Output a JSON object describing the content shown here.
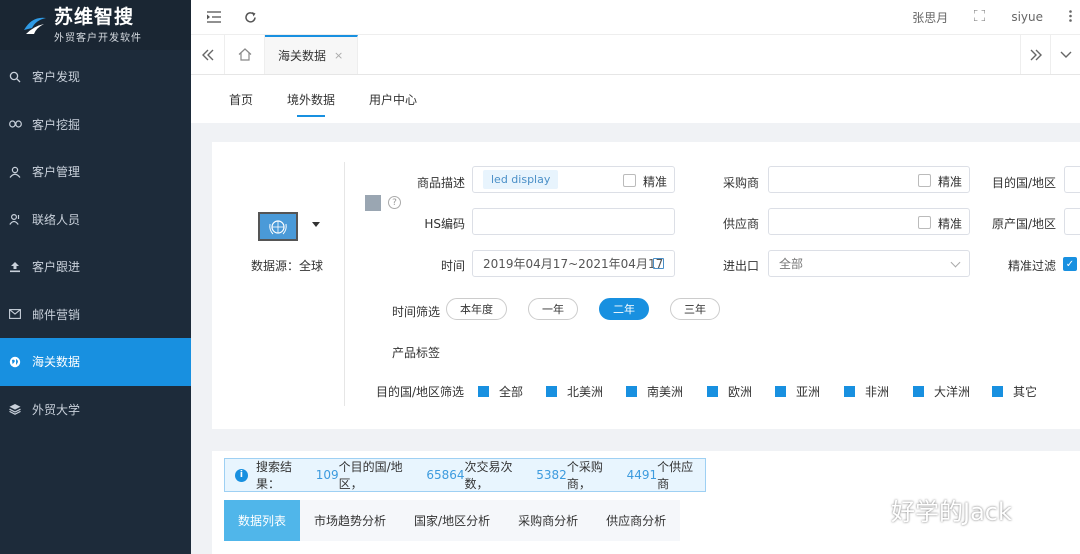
{
  "brand": {
    "title": "苏维智搜",
    "subtitle": "外贸客户开发软件"
  },
  "sidebar": {
    "items": [
      {
        "label": "客户发现",
        "icon": "search-icon"
      },
      {
        "label": "客户挖掘",
        "icon": "link-icon"
      },
      {
        "label": "客户管理",
        "icon": "user-icon"
      },
      {
        "label": "联络人员",
        "icon": "contact-icon"
      },
      {
        "label": "客户跟进",
        "icon": "upload-icon"
      },
      {
        "label": "邮件营销",
        "icon": "mail-icon"
      },
      {
        "label": "海关数据",
        "icon": "globe-icon",
        "active": true
      },
      {
        "label": "外贸大学",
        "icon": "layers-icon"
      }
    ]
  },
  "topbar": {
    "user_name": "张思月",
    "account": "siyue"
  },
  "tabstrip": {
    "open_tab": "海关数据"
  },
  "subnav": {
    "items": [
      "首页",
      "境外数据",
      "用户中心"
    ],
    "active": "境外数据"
  },
  "search": {
    "datasource_label": "数据源：全球",
    "product_desc_label": "商品描述",
    "product_desc_tag": "led display",
    "exact_label": "精准",
    "buyer_label": "采购商",
    "dest_country_label": "目的国/地区",
    "hs_label": "HS编码",
    "supplier_label": "供应商",
    "origin_country_label": "原产国/地区",
    "time_label": "时间",
    "time_value": "2019年04月17~2021年04月17",
    "io_label": "进出口",
    "io_value": "全部",
    "exact_filter_label": "精准过滤",
    "time_filter_label": "时间筛选",
    "time_filters": [
      "本年度",
      "一年",
      "二年",
      "三年"
    ],
    "time_filter_active": "二年",
    "product_tags_label": "产品标签",
    "region_filter_label": "目的国/地区筛选",
    "regions": [
      "全部",
      "北美洲",
      "南美洲",
      "欧洲",
      "亚洲",
      "非洲",
      "大洋洲",
      "其它"
    ]
  },
  "result": {
    "prefix": "搜索结果：",
    "dest_count": "109",
    "dest_suffix": "个目的国/地区，",
    "trade_count": "65864",
    "trade_suffix": "次交易次数，",
    "buyer_count": "5382",
    "buyer_suffix": "个采购商，",
    "supplier_count": "4491",
    "supplier_suffix": "个供应商"
  },
  "result_tabs": [
    "数据列表",
    "市场趋势分析",
    "国家/地区分析",
    "采购商分析",
    "供应商分析"
  ],
  "watermark": "好学的Jack",
  "colors": {
    "sidebar_bg": "#1d2b3a",
    "accent": "#1890e0",
    "tab_active": "#50b6ea"
  }
}
